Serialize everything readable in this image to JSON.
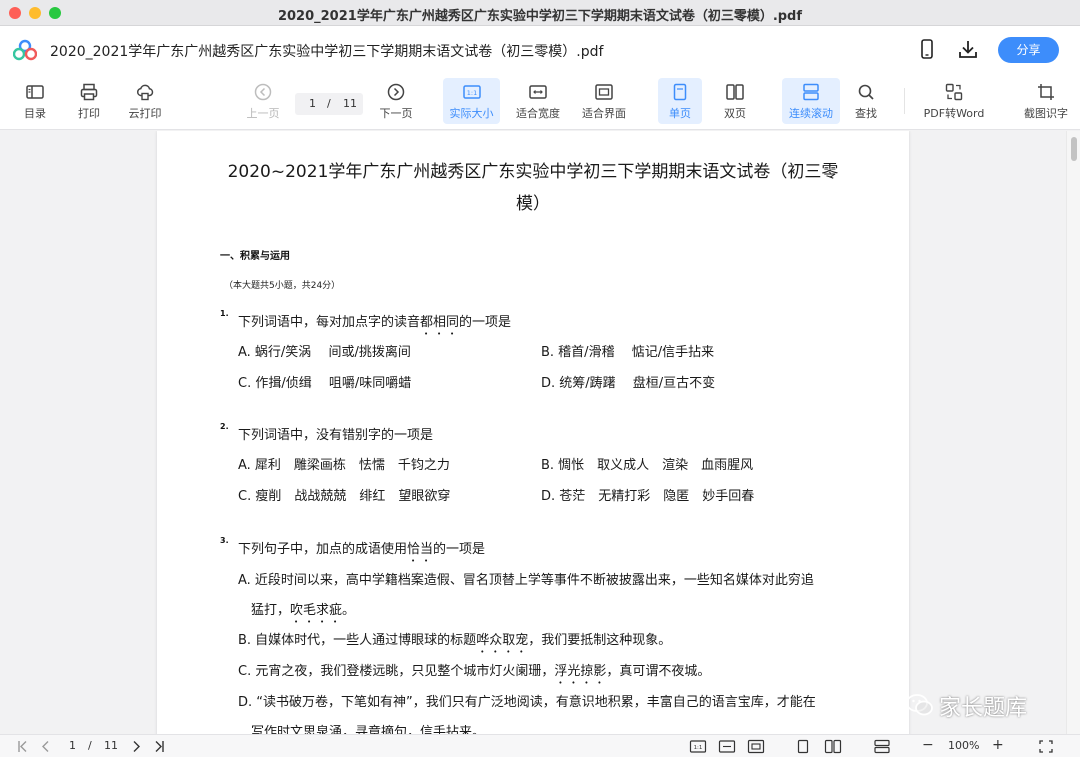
{
  "window": {
    "title": "2020_2021学年广东广州越秀区广东实验中学初三下学期期末语文试卷（初三零模）.pdf"
  },
  "docbar": {
    "doc_title": "2020_2021学年广东广州越秀区广东实验中学初三下学期期末语文试卷（初三零模）.pdf",
    "share_label": "分享",
    "icons": [
      "app-logo-icon",
      "phone-icon",
      "download-icon"
    ]
  },
  "toolbar": {
    "toc": "目录",
    "print": "打印",
    "cloud_print": "云打印",
    "prev_page": "上一页",
    "current_page": "1",
    "page_sep": "/",
    "total_pages": "11",
    "next_page": "下一页",
    "actual_size": "实际大小",
    "fit_width": "适合宽度",
    "fit_screen": "适合界面",
    "single_page": "单页",
    "double_page": "双页",
    "continuous_scroll": "连续滚动",
    "find": "查找",
    "pdf_to_word": "PDF转Word",
    "screenshot_ocr": "截图识字",
    "accent_color": "#3d8dfb"
  },
  "document": {
    "title_line1": "2020~2021学年广东广州越秀区广东实验中学初三下学期期末语文试卷（初三零",
    "title_line2": "模）",
    "section1": "一、积累与运用",
    "section1_note": "（本大题共5小题，共24分）",
    "q1": {
      "num": "1.",
      "text_a": "下列词语中，每对加点字的读音",
      "text_dot": "都相同",
      "text_b": "的一项是",
      "opt_a": "A. 蜗行/笑涡　 间或/挑拨离间",
      "opt_b": "B. 稽首/滑稽　 惦记/信手拈来",
      "opt_c": "C. 作揖/侦缉　 咀嚼/味同嚼蜡",
      "opt_d": "D. 统筹/踌躇　 盘桓/亘古不变"
    },
    "q2": {
      "num": "2.",
      "text": "下列词语中，没有错别字的一项是",
      "opt_a": "A. 犀利　雕梁画栋　怯懦　千钧之力",
      "opt_b": "B. 惆怅　取义成人　渲染　血雨腥风",
      "opt_c": "C. 瘦削　战战兢兢　绯红　望眼欲穿",
      "opt_d": "D. 苍茫　无精打彩　隐匿　妙手回春"
    },
    "q3": {
      "num": "3.",
      "text_a": "下列句子中，加点的成语使用",
      "text_dot": "恰当",
      "text_b": "的一项是",
      "opt_a_1": "A. 近段时间以来，高中学籍档案造假、冒名顶替上学等事件不断被披露出来，一些知名媒体对此穷追",
      "opt_a_2a": "猛打，",
      "opt_a_2dot": "吹毛求疵",
      "opt_a_2b": "。",
      "opt_b_a": "B. 自媒体时代，一些人通过博眼球的标题",
      "opt_b_dot": "哗众取宠",
      "opt_b_b": "，我们要抵制这种现象。",
      "opt_c_a": "C. 元宵之夜，我们登楼远眺，只见整个城市灯火阑珊，",
      "opt_c_dot": "浮光掠影",
      "opt_c_b": "，真可谓不夜城。",
      "opt_d_1": "D. “读书破万卷，下笔如有神”，我们只有广泛地阅读，有意识地积累，丰富自己的语言宝库，才能在",
      "opt_d_2": "写作时文思泉涌，寻章摘句，信手拈来。"
    }
  },
  "watermark": {
    "text": "家长题库"
  },
  "statusbar": {
    "current_page": "1",
    "page_sep": "/",
    "total_pages": "11",
    "zoom": "100%",
    "zoom_out": "−",
    "zoom_in": "+"
  }
}
